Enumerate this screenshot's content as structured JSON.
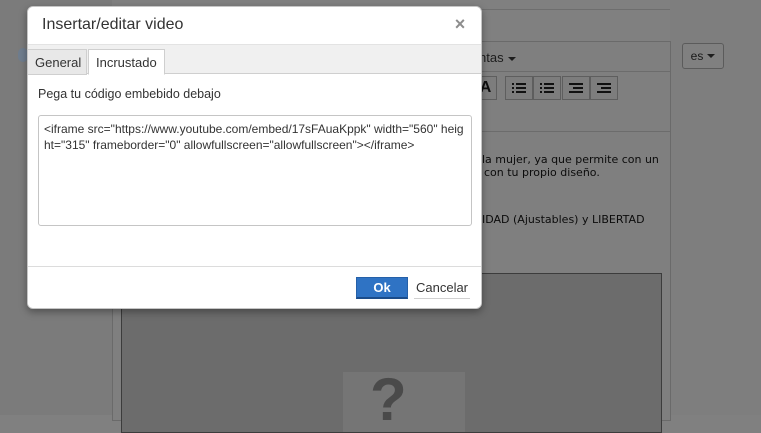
{
  "background": {
    "menu_fonts_label": "ntas",
    "lang_label": "es",
    "text_lines": [
      "la mujer, ya que permite con un",
      "con tu propio diseño.",
      "IDAD (Ajustables) y LIBERTAD"
    ],
    "embed_placeholder_glyph": "?"
  },
  "dialog": {
    "title": "Insertar/editar video",
    "close_glyph": "×",
    "tabs": [
      {
        "label": "General",
        "active": false
      },
      {
        "label": "Incrustado",
        "active": true
      }
    ],
    "embed_label": "Pega tu código embebido debajo",
    "embed_code": "<iframe src=\"https://www.youtube.com/embed/17sFAuaKppk\" width=\"560\" height=\"315\" frameborder=\"0\" allowfullscreen=\"allowfullscreen\"></iframe>",
    "ok_label": "Ok",
    "cancel_label": "Cancelar"
  },
  "colors": {
    "primary_button": "#2f73c4",
    "overlay": "#808080"
  }
}
